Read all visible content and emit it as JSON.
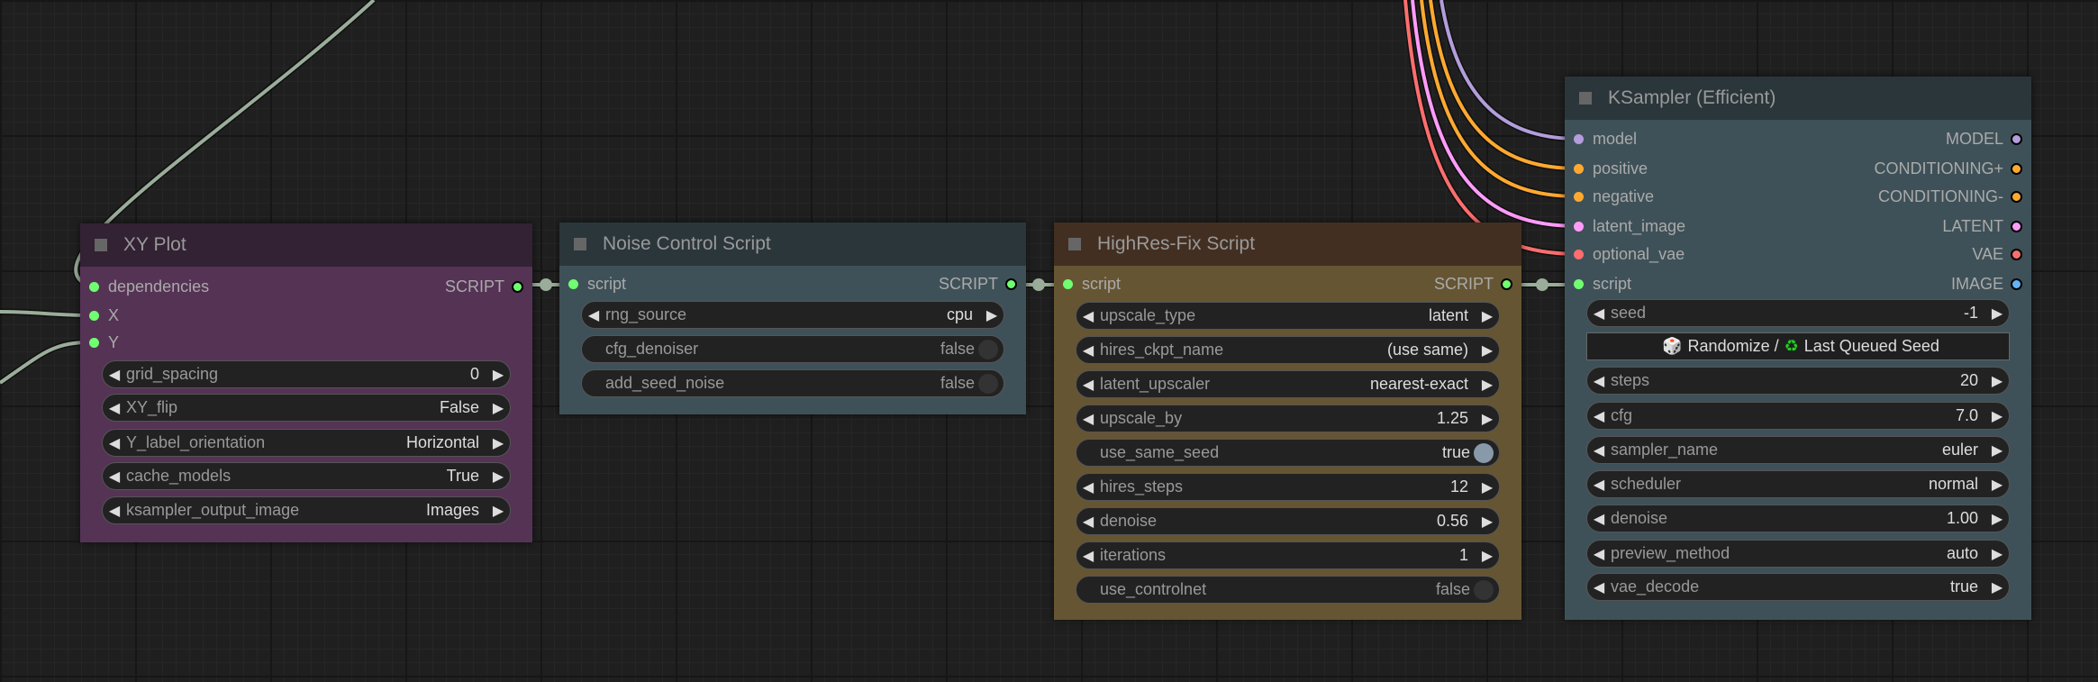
{
  "colors": {
    "script": "#70ff70",
    "model": "#b39ddb",
    "conditioning": "#ffa931",
    "latent": "#ff9cf9",
    "vae": "#ff6e6e",
    "image": "#64b5f6",
    "link": "#9aad9a"
  },
  "nodes": [
    {
      "id": "xy",
      "title": "XY Plot",
      "title_bg": "#332233",
      "body_bg": "#553355",
      "inputs": [
        {
          "label": "dependencies",
          "color": "script"
        },
        {
          "label": "X",
          "color": "script"
        },
        {
          "label": "Y",
          "color": "script"
        }
      ],
      "outputs": [
        {
          "label": "SCRIPT",
          "color": "script"
        }
      ],
      "widgets": [
        {
          "type": "combo",
          "label": "grid_spacing",
          "value": "0"
        },
        {
          "type": "combo",
          "label": "XY_flip",
          "value": "False"
        },
        {
          "type": "combo",
          "label": "Y_label_orientation",
          "value": "Horizontal"
        },
        {
          "type": "combo",
          "label": "cache_models",
          "value": "True"
        },
        {
          "type": "combo",
          "label": "ksampler_output_image",
          "value": "Images"
        }
      ]
    },
    {
      "id": "noise",
      "title": "Noise Control Script",
      "title_bg": "#2b363b",
      "body_bg": "#3f5158",
      "inputs": [
        {
          "label": "script",
          "color": "script"
        }
      ],
      "outputs": [
        {
          "label": "SCRIPT",
          "color": "script"
        }
      ],
      "widgets": [
        {
          "type": "combo",
          "label": "rng_source",
          "value": "cpu"
        },
        {
          "type": "toggle",
          "label": "cfg_denoiser",
          "value": "false",
          "on": false
        },
        {
          "type": "toggle",
          "label": "add_seed_noise",
          "value": "false",
          "on": false
        }
      ]
    },
    {
      "id": "hires",
      "title": "HighRes-Fix Script",
      "title_bg": "#432f22",
      "body_bg": "#665533",
      "inputs": [
        {
          "label": "script",
          "color": "script"
        }
      ],
      "outputs": [
        {
          "label": "SCRIPT",
          "color": "script"
        }
      ],
      "widgets": [
        {
          "type": "combo",
          "label": "upscale_type",
          "value": "latent"
        },
        {
          "type": "combo",
          "label": "hires_ckpt_name",
          "value": "(use same)"
        },
        {
          "type": "combo",
          "label": "latent_upscaler",
          "value": "nearest-exact"
        },
        {
          "type": "combo",
          "label": "upscale_by",
          "value": "1.25"
        },
        {
          "type": "toggle",
          "label": "use_same_seed",
          "value": "true",
          "on": true
        },
        {
          "type": "combo",
          "label": "hires_steps",
          "value": "12"
        },
        {
          "type": "combo",
          "label": "denoise",
          "value": "0.56"
        },
        {
          "type": "combo",
          "label": "iterations",
          "value": "1"
        },
        {
          "type": "toggle",
          "label": "use_controlnet",
          "value": "false",
          "on": false
        }
      ]
    },
    {
      "id": "ks",
      "title": "KSampler (Efficient)",
      "title_bg": "#2b363b",
      "body_bg": "#3f5158",
      "inputs": [
        {
          "label": "model",
          "color": "model"
        },
        {
          "label": "positive",
          "color": "conditioning"
        },
        {
          "label": "negative",
          "color": "conditioning"
        },
        {
          "label": "latent_image",
          "color": "latent"
        },
        {
          "label": "optional_vae",
          "color": "vae"
        },
        {
          "label": "script",
          "color": "script"
        }
      ],
      "outputs": [
        {
          "label": "MODEL",
          "color": "model"
        },
        {
          "label": "CONDITIONING+",
          "color": "conditioning"
        },
        {
          "label": "CONDITIONING-",
          "color": "conditioning"
        },
        {
          "label": "LATENT",
          "color": "latent"
        },
        {
          "label": "VAE",
          "color": "vae"
        },
        {
          "label": "IMAGE",
          "color": "image"
        }
      ],
      "widgets": [
        {
          "type": "combo",
          "label": "seed",
          "value": "-1"
        },
        {
          "type": "button",
          "label": "Randomize /",
          "label2": "Last Queued Seed",
          "icon1": "dice-icon",
          "icon2": "recycle-icon"
        },
        {
          "type": "combo",
          "label": "steps",
          "value": "20"
        },
        {
          "type": "combo",
          "label": "cfg",
          "value": "7.0"
        },
        {
          "type": "combo",
          "label": "sampler_name",
          "value": "euler"
        },
        {
          "type": "combo",
          "label": "scheduler",
          "value": "normal"
        },
        {
          "type": "combo",
          "label": "denoise",
          "value": "1.00"
        },
        {
          "type": "combo",
          "label": "preview_method",
          "value": "auto"
        },
        {
          "type": "combo",
          "label": "vae_decode",
          "value": "true"
        }
      ]
    }
  ]
}
